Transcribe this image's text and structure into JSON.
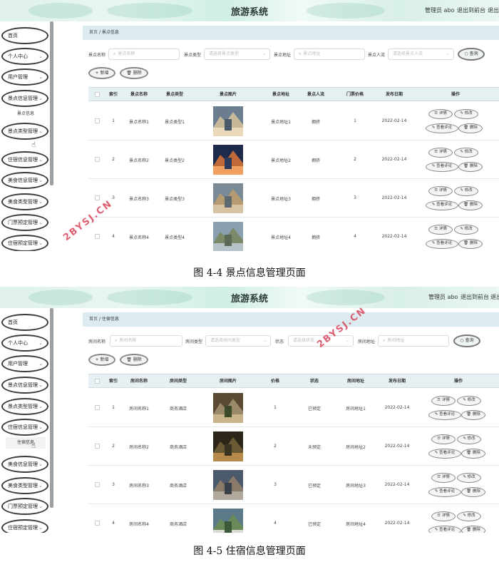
{
  "app": {
    "title": "旅游系统",
    "user_label": "管理员 abo",
    "back_label": "退出到前台",
    "logout_label": "退出"
  },
  "watermark": "2BYSJ.CN",
  "figures": [
    {
      "caption": "图 4-4  景点信息管理页面",
      "sidebar": [
        {
          "label": "首页",
          "chev": ""
        },
        {
          "label": "个人中心",
          "chev": "⌄"
        },
        {
          "label": "用户管理",
          "chev": "⌄"
        },
        {
          "label": "景点信息管理",
          "chev": "⌄"
        },
        {
          "label": "景点类型管理",
          "chev": "⌄"
        },
        {
          "label": "住宿信息管理",
          "chev": "⌄"
        },
        {
          "label": "美食信息管理",
          "chev": "⌄"
        },
        {
          "label": "美食类型管理",
          "chev": "⌄"
        },
        {
          "label": "门票预定管理",
          "chev": "⌄"
        },
        {
          "label": "住宿预定管理",
          "chev": "⌄"
        }
      ],
      "submenu": "景点信息",
      "breadcrumb": {
        "home": "首页",
        "sep": "/",
        "current": "景点信息"
      },
      "filters": [
        {
          "label": "景点名称",
          "placeholder": "景点名称",
          "type": "search"
        },
        {
          "label": "景点类型",
          "placeholder": "请选择景点类型",
          "type": "select"
        },
        {
          "label": "景点地址",
          "placeholder": "景点地址",
          "type": "search"
        },
        {
          "label": "景点人流",
          "placeholder": "请选择景点人流",
          "type": "select"
        }
      ],
      "query_label": "查询",
      "add_label": "+ 新增",
      "delete_label": "删除",
      "columns": [
        "索引",
        "景点名称",
        "景点类型",
        "景点图片",
        "景点地址",
        "景点人流",
        "门票价格",
        "发布日期",
        "操作"
      ],
      "rows": [
        {
          "index": "1",
          "name": "景点名称1",
          "type": "景点类型1",
          "addr": "景点地址1",
          "flow": "拥挤",
          "price": "1",
          "date": "2022-02-14"
        },
        {
          "index": "2",
          "name": "景点名称2",
          "type": "景点类型2",
          "addr": "景点地址2",
          "flow": "拥挤",
          "price": "2",
          "date": "2022-02-14"
        },
        {
          "index": "3",
          "name": "景点名称3",
          "type": "景点类型3",
          "addr": "景点地址3",
          "flow": "拥挤",
          "price": "3",
          "date": "2022-02-14"
        },
        {
          "index": "4",
          "name": "景点名称4",
          "type": "景点类型4",
          "addr": "景点地址4",
          "flow": "拥挤",
          "price": "4",
          "date": "2022-02-14"
        }
      ],
      "ops": [
        "详情",
        "修改",
        "查看评论",
        "删除"
      ]
    },
    {
      "caption": "图 4-5  住宿信息管理页面",
      "sidebar": [
        {
          "label": "首页",
          "chev": ""
        },
        {
          "label": "个人中心",
          "chev": "⌄"
        },
        {
          "label": "用户管理",
          "chev": "⌄"
        },
        {
          "label": "景点信息管理",
          "chev": "⌄"
        },
        {
          "label": "景点类型管理",
          "chev": "⌄"
        },
        {
          "label": "住宿信息管理",
          "chev": "⌄"
        },
        {
          "label": "美食信息管理",
          "chev": "⌄"
        },
        {
          "label": "美食类型管理",
          "chev": "⌄"
        },
        {
          "label": "门票预定管理",
          "chev": "⌄"
        },
        {
          "label": "住宿预定管理",
          "chev": "⌄"
        }
      ],
      "submenu": "住宿信息",
      "breadcrumb": {
        "home": "首页",
        "sep": "/",
        "current": "住宿信息"
      },
      "filters": [
        {
          "label": "房间名称",
          "placeholder": "房间名称",
          "type": "search"
        },
        {
          "label": "房间类型",
          "placeholder": "请选择房间类型",
          "type": "select"
        },
        {
          "label": "状态",
          "placeholder": "请选择状态",
          "type": "select"
        },
        {
          "label": "房间地址",
          "placeholder": "房间地址",
          "type": "search"
        }
      ],
      "query_label": "查询",
      "add_label": "+ 新增",
      "delete_label": "删除",
      "columns": [
        "索引",
        "房间名称",
        "房间类型",
        "房间图片",
        "价格",
        "状态",
        "房间地址",
        "发布日期",
        "操作"
      ],
      "rows": [
        {
          "index": "1",
          "name": "房间名称1",
          "type": "商务酒店",
          "addr": "1",
          "flow": "已预定",
          "price": "房间地址1",
          "date": "2022-02-14"
        },
        {
          "index": "2",
          "name": "房间名称2",
          "type": "商务酒店",
          "addr": "2",
          "flow": "未预定",
          "price": "房间地址2",
          "date": "2022-02-14"
        },
        {
          "index": "3",
          "name": "房间名称3",
          "type": "商务酒店",
          "addr": "3",
          "flow": "已预定",
          "price": "房间地址3",
          "date": "2022-02-14"
        },
        {
          "index": "4",
          "name": "房间名称4",
          "type": "商务酒店",
          "addr": "4",
          "flow": "已预定",
          "price": "房间地址4",
          "date": "2022-02-14"
        }
      ],
      "ops": [
        "详情",
        "修改",
        "查看评论",
        "删除"
      ]
    }
  ],
  "icons": {
    "search": "search-icon",
    "select": "chevron-down-icon",
    "detail": "document-icon",
    "edit": "pencil-icon",
    "comment": "comment-icon",
    "trash": "trash-icon",
    "cursor": "hand-cursor-icon"
  }
}
